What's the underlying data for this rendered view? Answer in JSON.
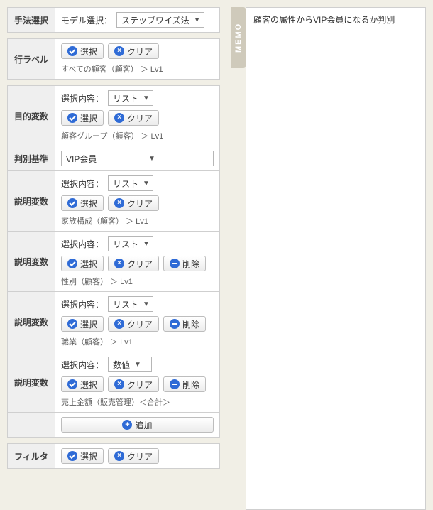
{
  "labels": {
    "method_select": "手法選択",
    "model_select": "モデル選択：",
    "row_label": "行ラベル",
    "objective": "目的変数",
    "criterion": "判別基準",
    "explanatory": "説明変数",
    "filter": "フィルタ",
    "select_content": "選択内容："
  },
  "buttons": {
    "select": "選択",
    "clear": "クリア",
    "delete": "削除",
    "add": "追加"
  },
  "selects": {
    "method": "ステップワイズ法",
    "list": "リスト",
    "numeric": "数値",
    "criterion_value": "VIP会員"
  },
  "infos": {
    "row_label": "すべての顧客（顧客） ＞ Lv1",
    "objective": "顧客グループ（顧客） ＞ Lv1",
    "exp1": "家族構成（顧客） ＞ Lv1",
    "exp2": "性別（顧客） ＞ Lv1",
    "exp3": "職業（顧客） ＞ Lv1",
    "exp4": "売上金額（販売管理）＜合計＞"
  },
  "memo": {
    "tab": "MEMO",
    "text": "顧客の属性からVIP会員になるか判別"
  }
}
